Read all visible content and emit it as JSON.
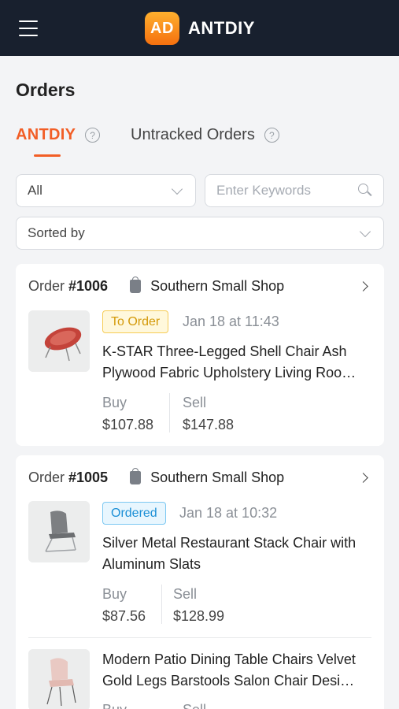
{
  "header": {
    "logo_badge": "AD",
    "logo_text": "ANTDIY",
    "menu_icon": "hamburger-menu-icon"
  },
  "page": {
    "title": "Orders"
  },
  "tabs": [
    {
      "label": "ANTDIY",
      "active": true,
      "help_icon": "?"
    },
    {
      "label": "Untracked Orders",
      "active": false,
      "help_icon": "?"
    }
  ],
  "filters": {
    "status_value": "All",
    "search_placeholder": "Enter Keywords",
    "sort_value": "Sorted by"
  },
  "orders": [
    {
      "order_label": "Order",
      "order_number": "#1006",
      "shop_name": "Southern Small Shop",
      "items": [
        {
          "status": "To Order",
          "date": "Jan 18 at 11:43",
          "title_line1": "K-STAR Three-Legged Shell Chair Ash",
          "title_line2": "Plywood Fabric Upholstery Living Roo…",
          "buy_label": "Buy",
          "buy_price": "$107.88",
          "sell_label": "Sell",
          "sell_price": "$147.88"
        }
      ]
    },
    {
      "order_label": "Order",
      "order_number": "#1005",
      "shop_name": "Southern Small Shop",
      "items": [
        {
          "status": "Ordered",
          "date": "Jan 18 at 10:32",
          "title_line1": "Silver Metal Restaurant Stack Chair with",
          "title_line2": "Aluminum Slats",
          "buy_label": "Buy",
          "buy_price": "$87.56",
          "sell_label": "Sell",
          "sell_price": "$128.99"
        },
        {
          "title_line1": "Modern Patio Dining Table Chairs Velvet",
          "title_line2": "Gold Legs Barstools Salon Chair Desi…",
          "buy_label": "Buy",
          "sell_label": "Sell"
        }
      ]
    }
  ],
  "colors": {
    "accent": "#f25e26",
    "header_bg": "#18202e",
    "to_order": "#d49a0a",
    "ordered": "#1b8fd6"
  }
}
